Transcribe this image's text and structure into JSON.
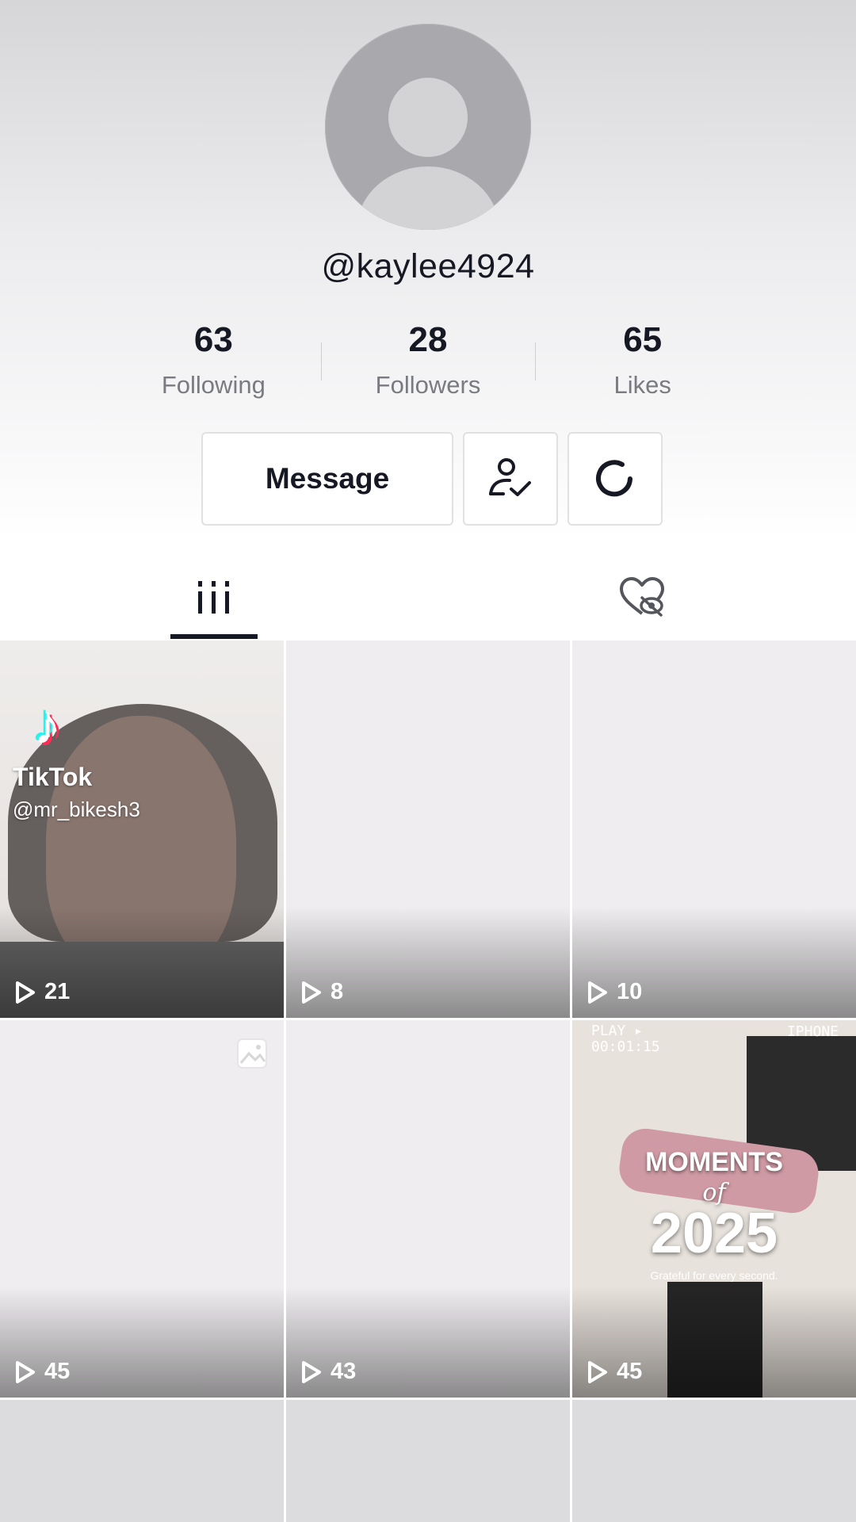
{
  "profile": {
    "username": "@kaylee4924"
  },
  "stats": [
    {
      "value": "63",
      "label": "Following"
    },
    {
      "value": "28",
      "label": "Followers"
    },
    {
      "value": "65",
      "label": "Likes"
    }
  ],
  "actions": {
    "message_label": "Message",
    "friends_icon": "user-check-icon",
    "refresh_icon": "refresh-icon"
  },
  "tabs": {
    "videos_icon": "grid-icon",
    "liked_icon": "liked-hidden-icon"
  },
  "videos": [
    {
      "views": "21",
      "watermark": {
        "brand": "TikTok",
        "handle": "@mr_bikesh3",
        "note": "♪"
      }
    },
    {
      "views": "8"
    },
    {
      "views": "10"
    },
    {
      "views": "45",
      "icon": "photo-icon"
    },
    {
      "views": "43"
    },
    {
      "views": "45",
      "overlay": {
        "top_left": "PLAY ▸\n00:01:15",
        "top_right": "IPHONE",
        "line1": "MOMENTS",
        "line2": "of",
        "line3": "2025",
        "line4": "Grateful for every second."
      }
    },
    {
      "views": ""
    },
    {
      "views": ""
    },
    {
      "views": ""
    }
  ],
  "colors": {
    "text_primary": "#161823",
    "text_secondary": "#7a7b80",
    "border": "#e1e1e4"
  }
}
